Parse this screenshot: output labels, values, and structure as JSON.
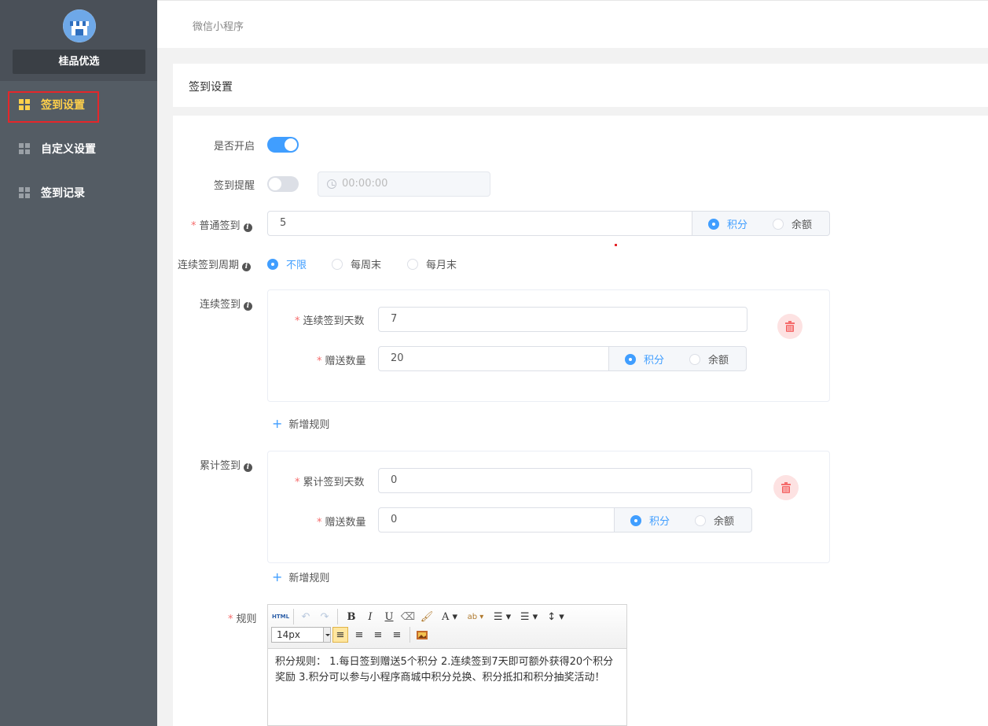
{
  "sidebar": {
    "shop_name": "桂品优选",
    "items": [
      {
        "label": "签到设置",
        "active": true
      },
      {
        "label": "自定义设置",
        "active": false
      },
      {
        "label": "签到记录",
        "active": false
      }
    ]
  },
  "header": {
    "breadcrumb": "微信小程序"
  },
  "page": {
    "title": "签到设置"
  },
  "form": {
    "enable": {
      "label": "是否开启",
      "on": true
    },
    "reminder": {
      "label": "签到提醒",
      "on": false,
      "time_placeholder": "00:00:00"
    },
    "normal_signin": {
      "label": "普通签到",
      "value": "5",
      "options": [
        "积分",
        "余额"
      ],
      "selected": "积分"
    },
    "cycle": {
      "label": "连续签到周期",
      "options": [
        "不限",
        "每周末",
        "每月末"
      ],
      "selected": "不限"
    },
    "continuous": {
      "label": "连续签到",
      "days_label": "连续签到天数",
      "days_value": "7",
      "amount_label": "赠送数量",
      "amount_value": "20",
      "options": [
        "积分",
        "余额"
      ],
      "selected": "积分",
      "add_label": "新增规则"
    },
    "cumulative": {
      "label": "累计签到",
      "days_label": "累计签到天数",
      "days_value": "0",
      "amount_label": "赠送数量",
      "amount_value": "0",
      "options": [
        "积分",
        "余额"
      ],
      "selected": "积分",
      "add_label": "新增规则"
    },
    "rules": {
      "label": "规则",
      "font_size": "14px",
      "html_btn": "HTML",
      "content": "积分规则： 1.每日签到赠送5个积分 2.连续签到7天即可额外获得20个积分奖励 3.积分可以参与小程序商城中积分兑换、积分抵扣和积分抽奖活动！"
    }
  },
  "colors": {
    "sidebar": "#545c64",
    "active": "#ffd04b",
    "primary": "#409eff",
    "danger": "#f56c6c"
  }
}
